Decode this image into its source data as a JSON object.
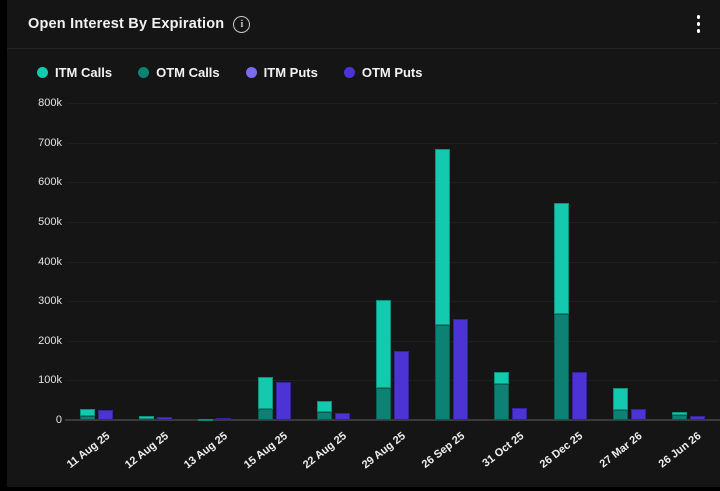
{
  "header": {
    "title": "Open Interest By Expiration",
    "info_glyph": "i"
  },
  "legend": [
    {
      "label": "ITM Calls",
      "color": "#13c9ae"
    },
    {
      "label": "OTM Calls",
      "color": "#0d8173"
    },
    {
      "label": "ITM Puts",
      "color": "#7a6cf0"
    },
    {
      "label": "OTM Puts",
      "color": "#4b33d6"
    }
  ],
  "chart_data": {
    "type": "bar",
    "stacked": true,
    "title": "Open Interest By Expiration",
    "categories": [
      "11 Aug 25",
      "12 Aug 25",
      "13 Aug 25",
      "15 Aug 25",
      "22 Aug 25",
      "29 Aug 25",
      "26 Sep 25",
      "31 Oct 25",
      "26 Dec 25",
      "27 Mar 26",
      "26 Jun 26"
    ],
    "series": [
      {
        "name": "ITM Calls",
        "stack": "calls",
        "color": "#13c9ae",
        "values": [
          17000,
          8000,
          1000,
          81000,
          27000,
          222000,
          445000,
          30000,
          280000,
          57000,
          8000
        ]
      },
      {
        "name": "OTM Calls",
        "stack": "calls",
        "color": "#0d8173",
        "values": [
          11000,
          3000,
          1000,
          27000,
          21000,
          80000,
          240000,
          90000,
          267000,
          25000,
          12000
        ]
      },
      {
        "name": "ITM Puts",
        "stack": "puts",
        "color": "#7a6cf0",
        "values": [
          0,
          0,
          0,
          0,
          0,
          0,
          0,
          0,
          0,
          0,
          0
        ]
      },
      {
        "name": "OTM Puts",
        "stack": "puts",
        "color": "#4b33d6",
        "values": [
          26000,
          8000,
          4000,
          96000,
          17000,
          173000,
          254000,
          31000,
          120000,
          29000,
          10000
        ]
      }
    ],
    "y_ticks": [
      "800k",
      "700k",
      "600k",
      "500k",
      "400k",
      "300k",
      "200k",
      "100k",
      "0"
    ],
    "ylim": [
      0,
      800000
    ],
    "grid": "horizontal",
    "legend_position": "top"
  }
}
